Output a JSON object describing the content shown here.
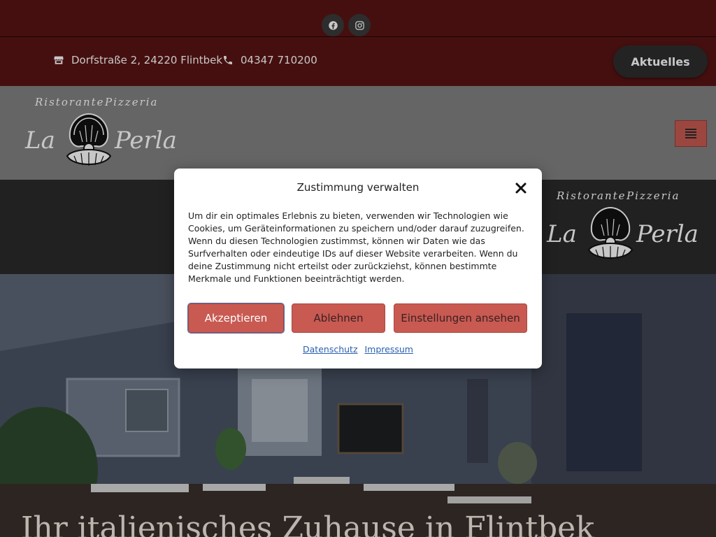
{
  "topbar": {
    "social": [
      {
        "name": "facebook-icon"
      },
      {
        "name": "instagram-icon"
      }
    ]
  },
  "infobar": {
    "address": "Dorfstraße 2, 24220 Flintbek",
    "phone": "04347 710200",
    "aktuelles_label": "Aktuelles"
  },
  "logo": {
    "subtitle_left": "Ristorante",
    "subtitle_right": "Pizzeria",
    "name_left": "La",
    "name_right": "Perla"
  },
  "hero": {
    "title": "Ihr italienisches Zuhause in Flintbek"
  },
  "consent": {
    "title": "Zustimmung verwalten",
    "body": "Um dir ein optimales Erlebnis zu bieten, verwenden wir Technologien wie Cookies, um Geräteinformationen zu speichern und/oder darauf zuzugreifen. Wenn du diesen Technologien zustimmst, können wir Daten wie das Surfverhalten oder eindeutige IDs auf dieser Website verarbeiten. Wenn du deine Zustimmung nicht erteilst oder zurückziehst, können bestimmte Merkmale und Funktionen beeinträchtigt werden.",
    "accept_label": "Akzeptieren",
    "deny_label": "Ablehnen",
    "prefs_label": "Einstellungen ansehen",
    "link_privacy": "Datenschutz",
    "link_imprint": "Impressum"
  },
  "colors": {
    "brand_red": "#5a1414",
    "accent": "#c85a52",
    "dark": "#2b2b2b"
  }
}
